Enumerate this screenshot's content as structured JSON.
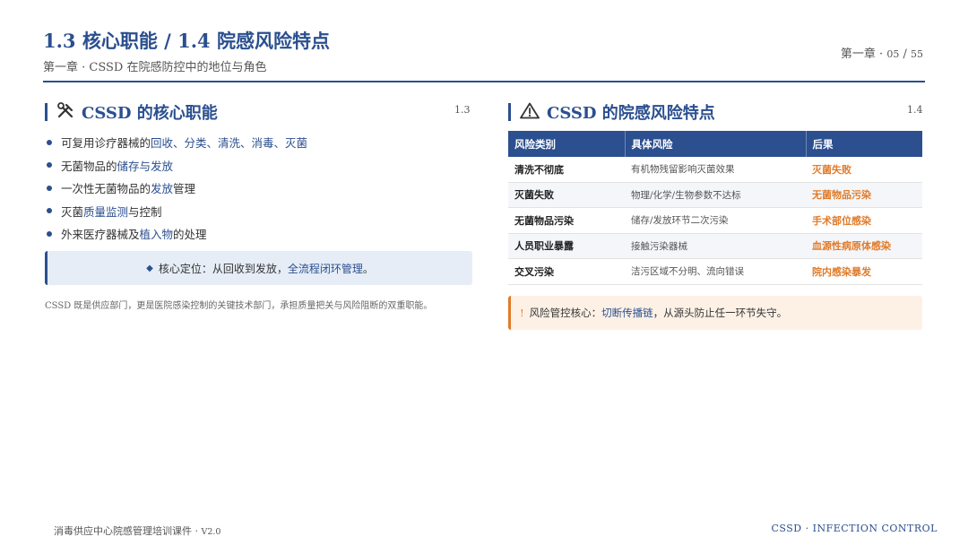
{
  "header": {
    "title": "1.3 核心职能 / 1.4 院感风险特点",
    "subtitle": "第一章 · CSSD 在院感防控中的地位与角色",
    "page_label": "第一章 ·",
    "page_current": "05",
    "page_sep": "/",
    "page_total": "55"
  },
  "left": {
    "title": "CSSD 的核心职能",
    "num": "1.3",
    "icon": "tools-icon",
    "bullets": [
      {
        "pre": "可复用诊疗器械的",
        "hl": "回收、分类、清洗、消毒、灭菌",
        "post": ""
      },
      {
        "pre": "无菌物品的",
        "hl": "储存与发放",
        "post": ""
      },
      {
        "pre": "一次性无菌物品的",
        "hl": "发放",
        "post": "管理"
      },
      {
        "pre": "灭菌",
        "hl": "质量监测",
        "post": "与控制"
      },
      {
        "pre": "外来医疗器械及",
        "hl": "植入物",
        "post": "的处理"
      }
    ],
    "core_pre": "核心定位：从回收到发放，",
    "core_strong": "全流程闭环管理",
    "core_post": "。",
    "note": "CSSD 既是供应部门，更是医院感染控制的关键技术部门，承担质量把关与风险阻断的双重职能。"
  },
  "right": {
    "title": "CSSD 的院感风险特点",
    "num": "1.4",
    "icon": "warning-icon",
    "table": {
      "headers": [
        "风险类别",
        "具体风险",
        "后果"
      ],
      "rows": [
        [
          "清洗不彻底",
          "有机物残留影响灭菌效果",
          "灭菌失败"
        ],
        [
          "灭菌失败",
          "物理/化学/生物参数不达标",
          "无菌物品污染"
        ],
        [
          "无菌物品污染",
          "储存/发放环节二次污染",
          "手术部位感染"
        ],
        [
          "人员职业暴露",
          "接触污染器械",
          "血源性病原体感染"
        ],
        [
          "交叉污染",
          "洁污区域不分明、流向错误",
          "院内感染暴发"
        ]
      ]
    },
    "warn_pre": "风险管控核心：",
    "warn_strong": "切断传播链",
    "warn_post": "，从源头防止任一环节失守。"
  },
  "footer": {
    "left": "消毒供应中心院感管理培训课件 ·",
    "left_version": "V2.0",
    "right": "CSSD · INFECTION CONTROL"
  },
  "colors": {
    "primary": "#2b4f8f",
    "accent": "#e07b2a"
  }
}
